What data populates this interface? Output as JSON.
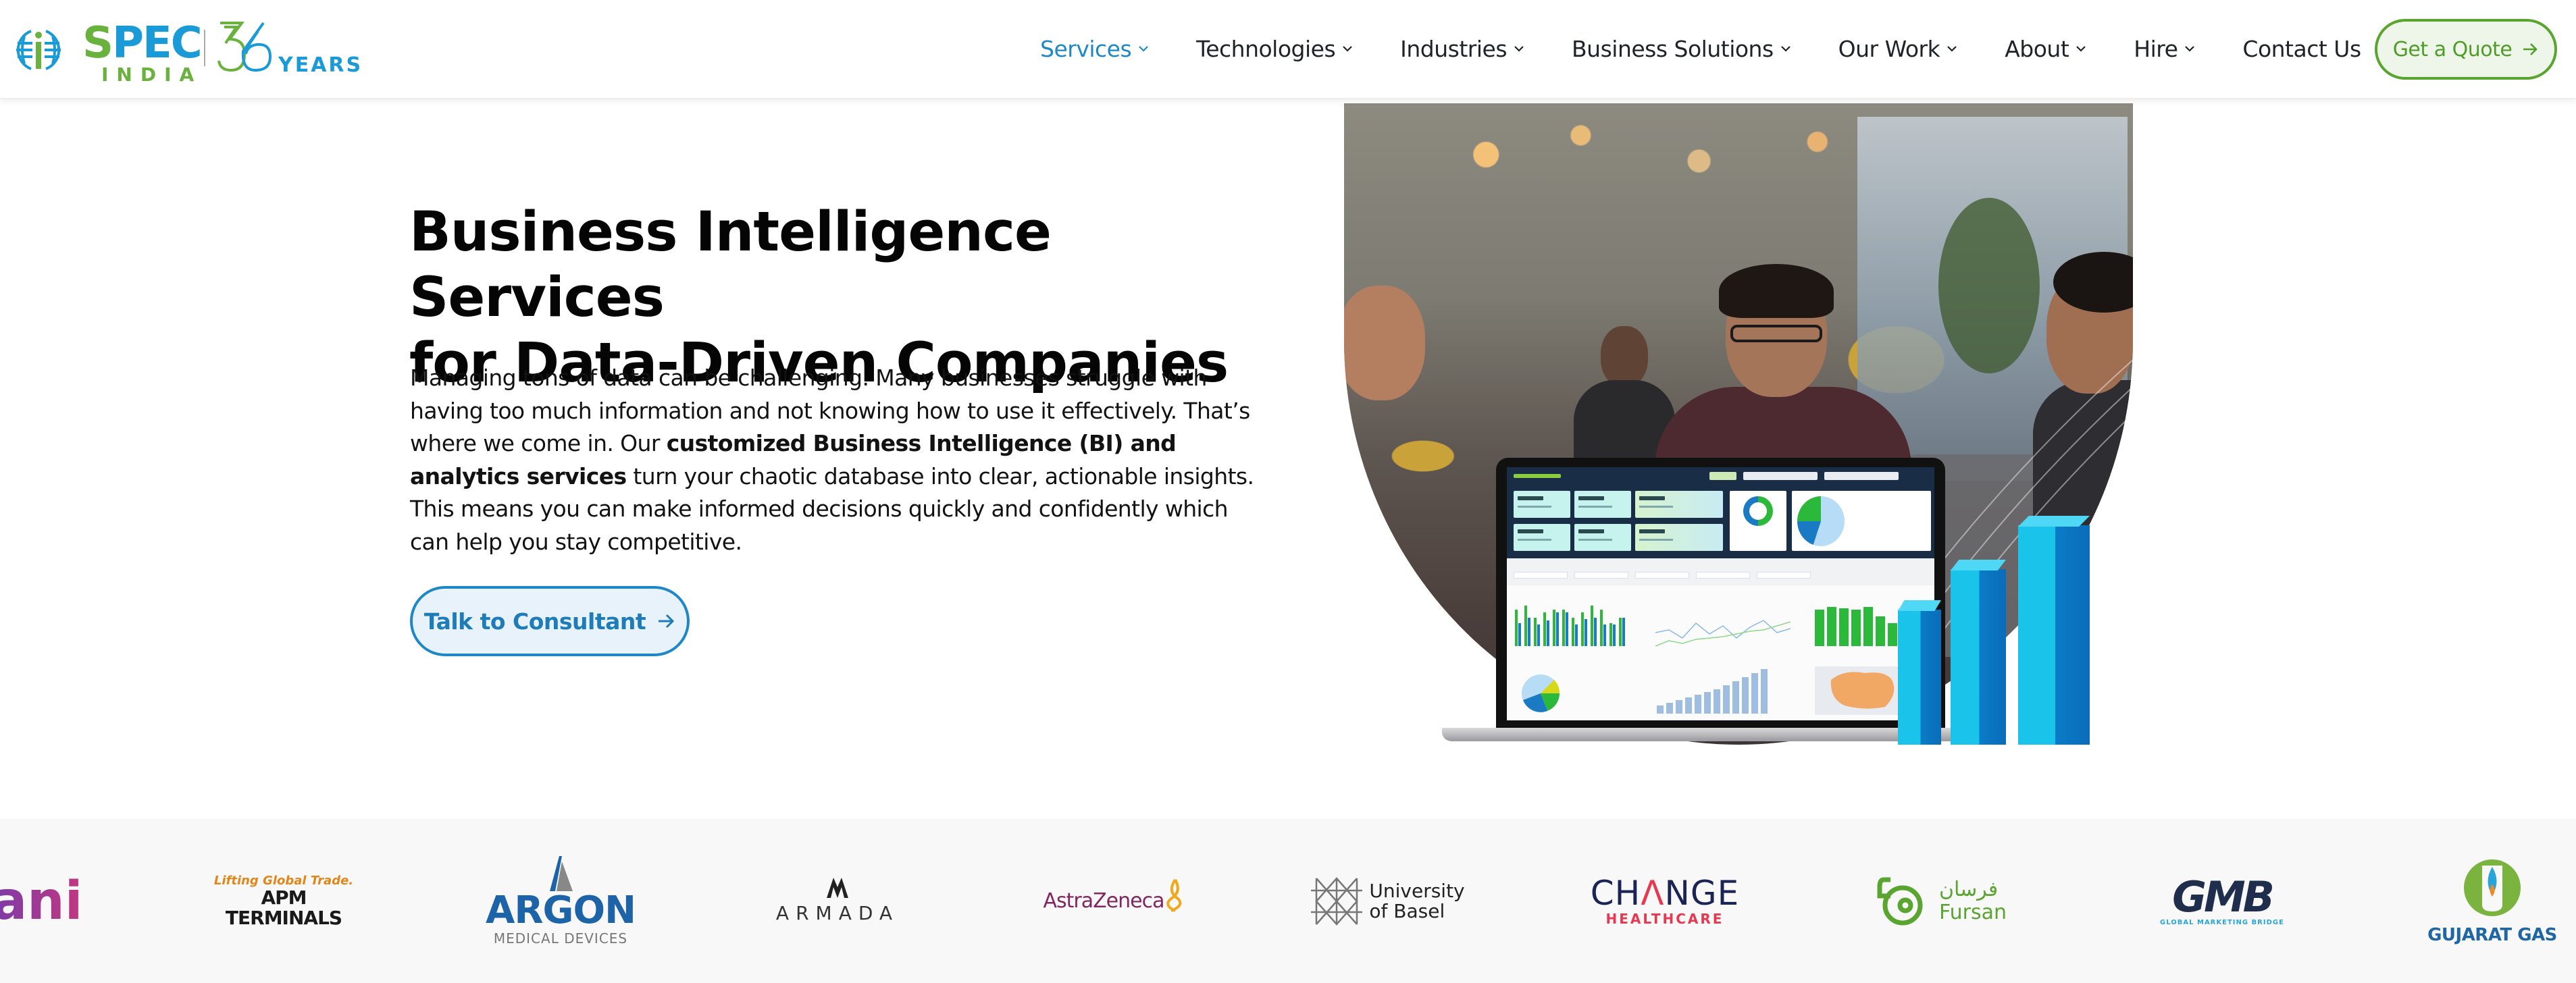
{
  "header": {
    "logo": {
      "brand": "SPEC",
      "brand_sub": "INDIA",
      "anniversary_number": "36",
      "anniversary_label": "YEARS"
    },
    "nav": [
      {
        "label": "Services",
        "has_dropdown": true,
        "active": true
      },
      {
        "label": "Technologies",
        "has_dropdown": true,
        "active": false
      },
      {
        "label": "Industries",
        "has_dropdown": true,
        "active": false
      },
      {
        "label": "Business Solutions",
        "has_dropdown": true,
        "active": false
      },
      {
        "label": "Our Work",
        "has_dropdown": true,
        "active": false
      },
      {
        "label": "About",
        "has_dropdown": true,
        "active": false
      },
      {
        "label": "Hire",
        "has_dropdown": true,
        "active": false
      },
      {
        "label": "Contact Us",
        "has_dropdown": false,
        "active": false
      }
    ],
    "cta_label": "Get a Quote"
  },
  "hero": {
    "title_line1": "Business Intelligence Services",
    "title_line2": "for Data-Driven Companies",
    "desc_part1": "Managing tons of data can be challenging. Many businesses struggle with having too much information and not knowing how to use it effectively. That’s where we come in. Our ",
    "desc_bold": "customized Business Intelligence (BI) and analytics services",
    "desc_part2": " turn your chaotic database into clear, actionable insights. This means you can make informed decisions quickly and confidently which can help you stay competitive.",
    "cta_label": "Talk to Consultant",
    "image_alt": "Team discussing a BI dashboard on a laptop with 3D bar chart"
  },
  "clients": {
    "ani": {
      "name": "ani"
    },
    "apm": {
      "tagline": "Lifting Global Trade.",
      "line1": "APM",
      "line2": "TERMINALS"
    },
    "argon": {
      "name": "ARGON",
      "sub": "MEDICAL DEVICES"
    },
    "armada": {
      "name": "ARMADA"
    },
    "astrazeneca": {
      "name": "AstraZeneca"
    },
    "basel": {
      "line1": "University",
      "line2": "of Basel"
    },
    "change": {
      "name_pre": "CH",
      "name_a": "Λ",
      "name_post": "NGE",
      "sub": "HEALTHCARE"
    },
    "fursan": {
      "arabic": "فرسان",
      "name": "Fursan"
    },
    "gmb": {
      "name": "GMB",
      "sub": "GLOBAL MARKETING BRIDGE"
    },
    "gujarat": {
      "name": "GUJARAT GAS"
    }
  },
  "colors": {
    "brand_blue": "#1a9ad6",
    "brand_green": "#6ab23e",
    "nav_active": "#1e88c7",
    "cta_green": "#5aa52f",
    "consult_blue": "#1e88c7"
  }
}
